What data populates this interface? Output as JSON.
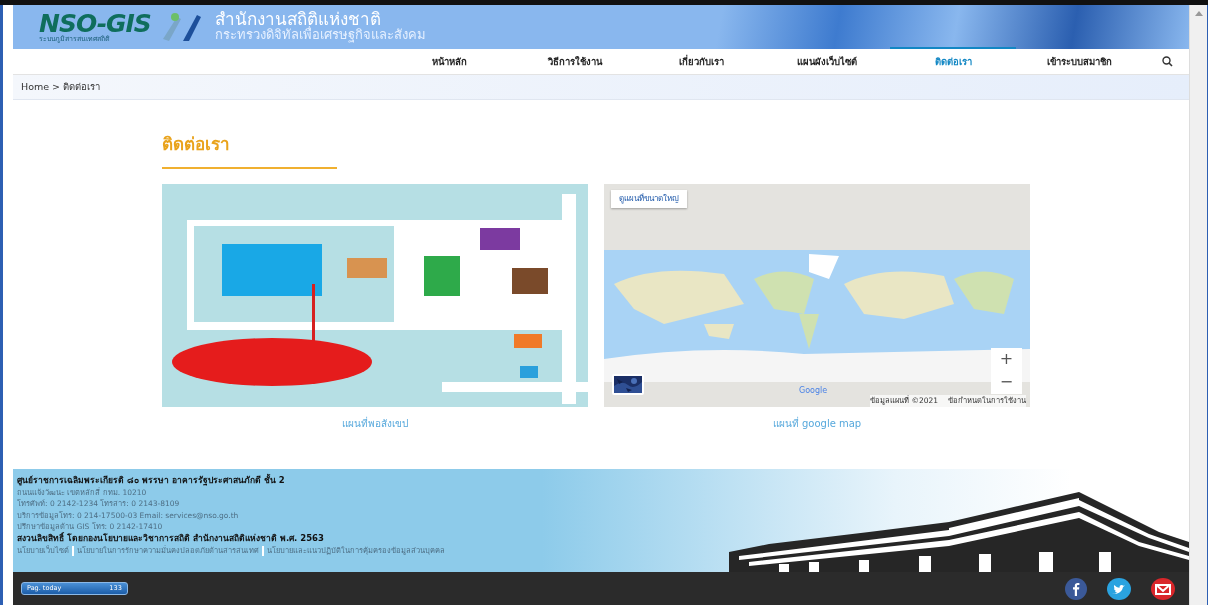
{
  "header": {
    "logo": "NSO-GIS",
    "logo_subtitle": "ระบบภูมิสารสนเทศสถิติ",
    "title": "สำนักงานสถิติแห่งชาติ",
    "subtitle": "กระทรวงดิจิทัลเพื่อเศรษฐกิจและสังคม"
  },
  "nav": [
    {
      "label": "หน้าหลัก",
      "selected": false
    },
    {
      "label": "วิธีการใช้งาน",
      "selected": false
    },
    {
      "label": "เกี่ยวกับเรา",
      "selected": false
    },
    {
      "label": "แผนผังเว็บไซต์",
      "selected": false
    },
    {
      "label": "ติดต่อเรา",
      "selected": true
    },
    {
      "label": "เข้าระบบสมาชิก",
      "selected": false
    }
  ],
  "breadcrumb": "Home > ติดต่อเรา",
  "heading": "ติดต่อเรา",
  "maps": [
    {
      "kind": "picture",
      "caption": "แผนที่พอสังเขป"
    },
    {
      "kind": "google",
      "caption": "แผนที่ google map",
      "larger_map_button": "ดูแผนที่ขนาดใหญ่",
      "zoom_in": "+",
      "zoom_out": "−",
      "logo": "Google",
      "attribution": "ข้อมูลแผนที่ ©2021",
      "terms": "ข้อกำหนดในการใช้งาน"
    }
  ],
  "footer": {
    "lines": [
      {
        "text": "ศูนย์ราชการเฉลิมพระเกียรติ ๘๐ พรรษา อาคารรัฐประศาสนภักดี ชั้น 2",
        "bold": true
      },
      {
        "text": "ถนนแจ้งวัฒนะ เขตหลักสี่ กทม. 10210",
        "bold": false
      },
      {
        "text": "โทรศัพท์: 0 2142-1234 โทรสาร: 0 2143-8109",
        "bold": false
      },
      {
        "text": "บริการข้อมูลโทร: 0 214-17500-03 Email: services@nso.go.th",
        "bold": false
      },
      {
        "text": "ปรึกษาข้อมูลด้าน GIS โทร: 0 2142-17410",
        "bold": false
      },
      {
        "text": "สงวนลิขสิทธิ์ โดยกองนโยบายและวิชาการสถิติ สำนักงานสถิติแห่งชาติ พ.ศ. 2563",
        "bold": true
      }
    ],
    "links": [
      "นโยบายเว็บไซต์",
      "นโยบายในการรักษาความมั่นคงปลอดภัยด้านสารสนเทศ",
      "นโยบายและแนวปฏิบัติในการคุ้มครองข้อมูลส่วนบุคคล"
    ]
  },
  "counter": {
    "label": "Pag. today",
    "value": "133"
  }
}
